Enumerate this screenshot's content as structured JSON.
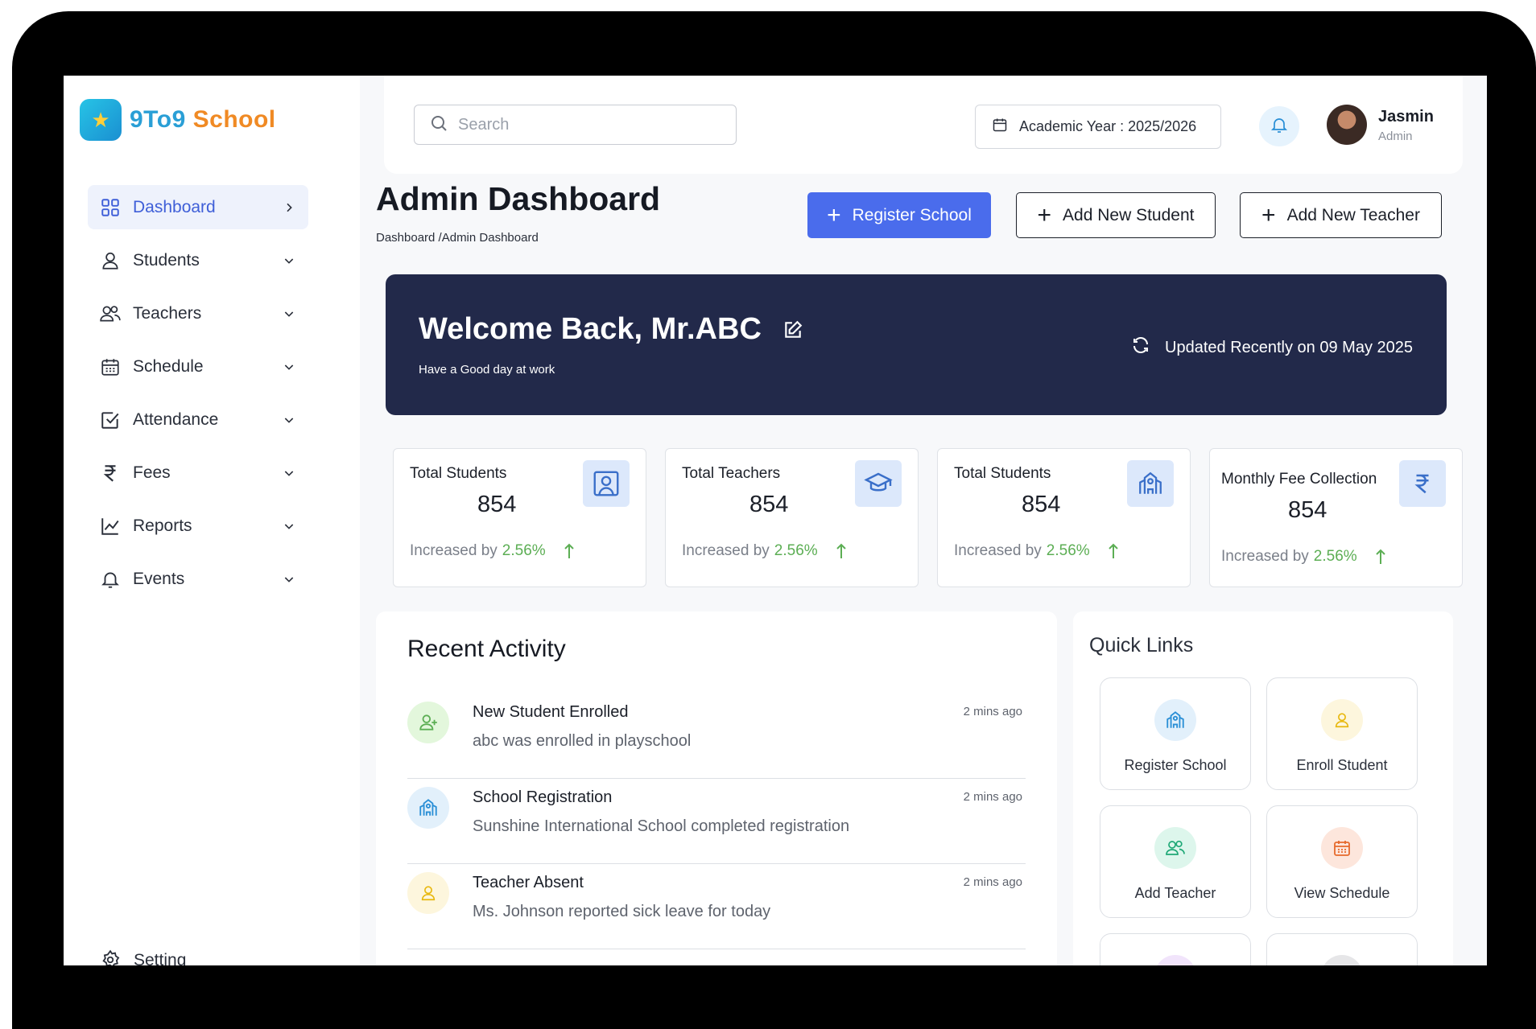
{
  "brand": {
    "name_part1": "9To9",
    "name_part2": "School",
    "colors": {
      "part1": "#2a9fd6",
      "part2": "#f08a24"
    }
  },
  "sidebar": {
    "items": [
      {
        "label": "Dashboard",
        "icon": "grid-icon",
        "active": true
      },
      {
        "label": "Students",
        "icon": "user-icon"
      },
      {
        "label": "Teachers",
        "icon": "users-icon"
      },
      {
        "label": "Schedule",
        "icon": "calendar-icon"
      },
      {
        "label": "Attendance",
        "icon": "checkbox-icon"
      },
      {
        "label": "Fees",
        "icon": "rupee-icon"
      },
      {
        "label": "Reports",
        "icon": "chart-line-icon"
      },
      {
        "label": "Events",
        "icon": "bell-icon"
      }
    ],
    "setting_label": "Setting"
  },
  "header": {
    "search_placeholder": "Search",
    "academic_year": "Academic Year : 2025/2026",
    "user_name": "Jasmin",
    "user_role": "Admin"
  },
  "page": {
    "title": "Admin Dashboard",
    "breadcrumb": "Dashboard /Admin Dashboard",
    "buttons": {
      "register": "Register School",
      "add_student": "Add New Student",
      "add_teacher": "Add New Teacher"
    }
  },
  "welcome": {
    "title": "Welcome Back, Mr.ABC",
    "subtitle": "Have a Good day at work",
    "updated": "Updated Recently on 09 May 2025"
  },
  "stats": [
    {
      "title": "Total Students",
      "value": "854",
      "increase_label": "Increased by",
      "increase_pct": "2.56%",
      "icon": "id-card-icon"
    },
    {
      "title": "Total Teachers",
      "value": "854",
      "increase_label": "Increased by",
      "increase_pct": "2.56%",
      "icon": "graduation-cap-icon"
    },
    {
      "title": "Total Students",
      "value": "854",
      "increase_label": "Increased by",
      "increase_pct": "2.56%",
      "icon": "school-icon"
    },
    {
      "title": "Monthly Fee Collection",
      "value": "854",
      "increase_label": "Increased by",
      "increase_pct": "2.56%",
      "icon": "rupee-icon"
    }
  ],
  "recent_activity": {
    "title": "Recent Activity",
    "items": [
      {
        "title": "New Student Enrolled",
        "desc": "abc was enrolled in playschool",
        "time": "2 mins ago",
        "icon": "user-plus-icon",
        "color": "#e3f7dc"
      },
      {
        "title": "School Registration",
        "desc": "Sunshine International School completed registration",
        "time": "2 mins ago",
        "icon": "school-icon",
        "color": "#e2f0fb"
      },
      {
        "title": "Teacher Absent",
        "desc": "Ms. Johnson reported sick leave for today",
        "time": "2 mins ago",
        "icon": "user-icon",
        "color": "#fdf6dd"
      }
    ]
  },
  "quick_links": {
    "title": "Quick Links",
    "items": [
      {
        "label": "Register School",
        "icon": "school-icon",
        "color": "#e2f0fb"
      },
      {
        "label": "Enroll Student",
        "icon": "user-icon",
        "color": "#fdf6dd"
      },
      {
        "label": "Add Teacher",
        "icon": "users-icon",
        "color": "#ddf6ec"
      },
      {
        "label": "View Schedule",
        "icon": "calendar-icon",
        "color": "#fde6dc"
      }
    ]
  }
}
